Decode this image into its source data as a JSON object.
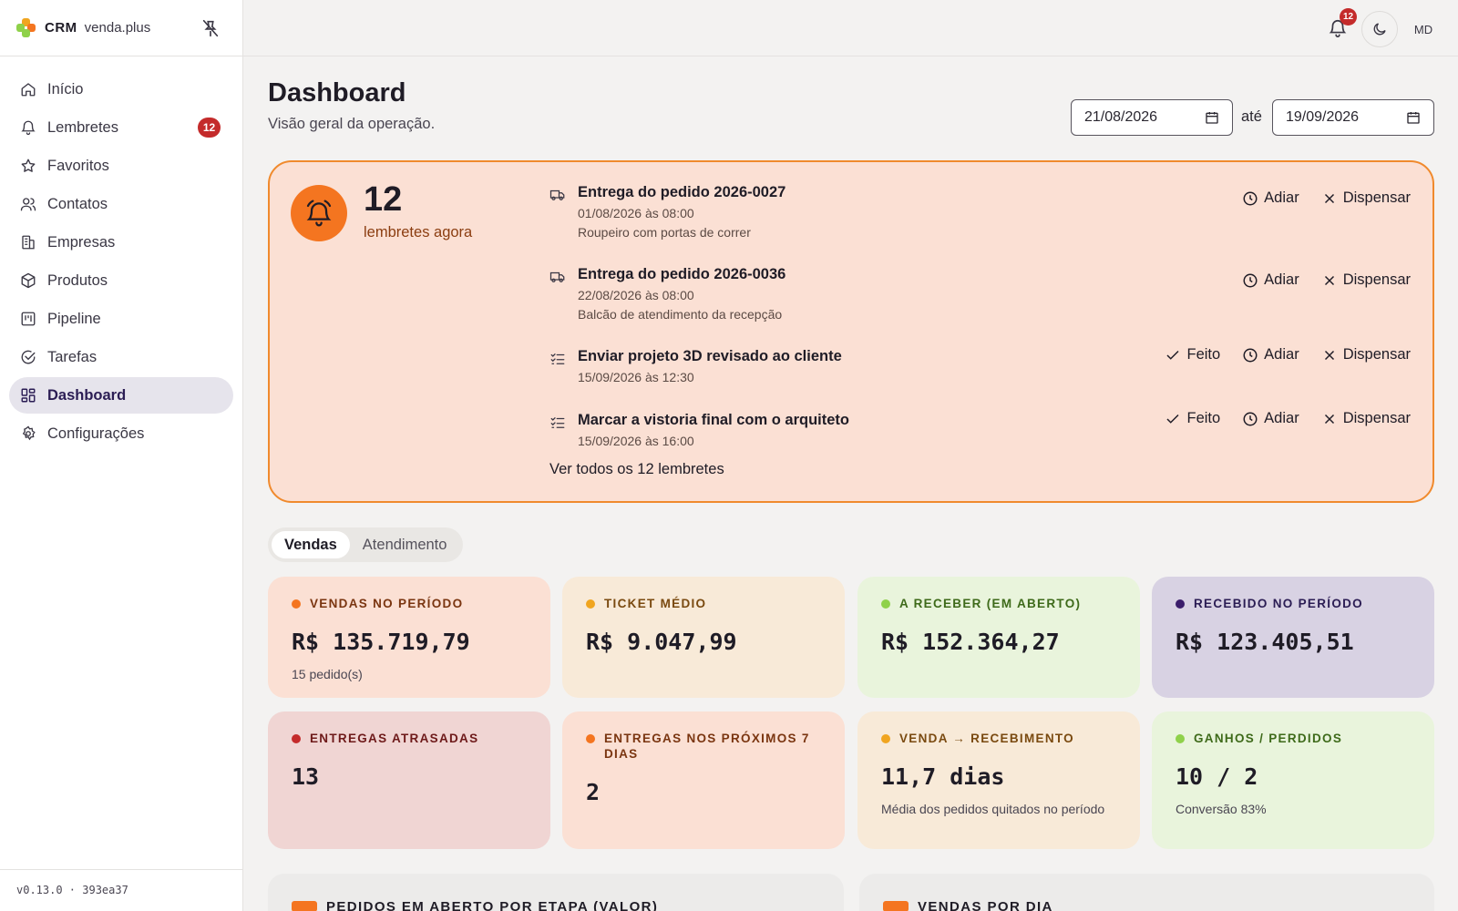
{
  "app": {
    "brand": "CRM",
    "brand_sub": "venda.plus",
    "version": "v0.13.0 · 393ea37"
  },
  "colors": {
    "accent": "#f47520",
    "badge": "#c42b2b",
    "active_nav": "#e6e4ec"
  },
  "sidebar": {
    "items": [
      {
        "label": "Início",
        "icon": "home-icon"
      },
      {
        "label": "Lembretes",
        "icon": "bell-icon",
        "badge": "12"
      },
      {
        "label": "Favoritos",
        "icon": "star-icon"
      },
      {
        "label": "Contatos",
        "icon": "users-icon"
      },
      {
        "label": "Empresas",
        "icon": "building-icon"
      },
      {
        "label": "Produtos",
        "icon": "package-icon"
      },
      {
        "label": "Pipeline",
        "icon": "kanban-icon"
      },
      {
        "label": "Tarefas",
        "icon": "check-circle-icon"
      },
      {
        "label": "Dashboard",
        "icon": "dashboard-icon",
        "active": true
      },
      {
        "label": "Configurações",
        "icon": "gear-icon"
      }
    ]
  },
  "topbar": {
    "notification_count": "12",
    "avatar_initials": "MD"
  },
  "header": {
    "title": "Dashboard",
    "subtitle": "Visão geral da operação.",
    "date_from": "21/08/2026",
    "date_separator": "até",
    "date_to": "19/09/2026"
  },
  "reminders": {
    "count": "12",
    "count_label": "lembretes agora",
    "items": [
      {
        "icon": "truck-icon",
        "title": "Entrega do pedido 2026-0027",
        "when": "01/08/2026 às 08:00",
        "description": "Roupeiro com portas de correr",
        "actions": [
          "Adiar",
          "Dispensar"
        ]
      },
      {
        "icon": "truck-icon",
        "title": "Entrega do pedido 2026-0036",
        "when": "22/08/2026 às 08:00",
        "description": "Balcão de atendimento da recepção",
        "actions": [
          "Adiar",
          "Dispensar"
        ]
      },
      {
        "icon": "task-list-icon",
        "title": "Enviar projeto 3D revisado ao cliente",
        "when": "15/09/2026 às 12:30",
        "description": "",
        "actions": [
          "Feito",
          "Adiar",
          "Dispensar"
        ]
      },
      {
        "icon": "task-list-icon",
        "title": "Marcar a vistoria final com o arquiteto",
        "when": "15/09/2026 às 16:00",
        "description": "",
        "actions": [
          "Feito",
          "Adiar",
          "Dispensar"
        ]
      }
    ],
    "view_all": "Ver todos os 12 lembretes"
  },
  "tabs": [
    {
      "label": "Vendas",
      "active": true
    },
    {
      "label": "Atendimento",
      "active": false
    }
  ],
  "kpis": [
    {
      "label": "Vendas no período",
      "value": "R$ 135.719,79",
      "sub": "15 pedido(s)",
      "bg": "#fbe0d4",
      "dot": "#f47520",
      "label_color": "#7a3510"
    },
    {
      "label": "Ticket médio",
      "value": "R$ 9.047,99",
      "sub": "",
      "bg": "#f8ead8",
      "dot": "#f0a520",
      "label_color": "#7a4a10"
    },
    {
      "label": "A receber (em aberto)",
      "value": "R$ 152.364,27",
      "sub": "",
      "bg": "#e9f4dc",
      "dot": "#8fd14a",
      "label_color": "#3e6a1a"
    },
    {
      "label": "Recebido no período",
      "value": "R$ 123.405,51",
      "sub": "",
      "bg": "#d8d2e3",
      "dot": "#3b1d6b",
      "label_color": "#2b1d54"
    },
    {
      "label": "Entregas atrasadas",
      "value": "13",
      "sub": "",
      "bg": "#f0d5d3",
      "dot": "#c42b2b",
      "label_color": "#6e1a1a"
    },
    {
      "label": "Entregas nos próximos 7 dias",
      "value": "2",
      "sub": "",
      "bg": "#fbe0d4",
      "dot": "#f47520",
      "label_color": "#7a3510"
    },
    {
      "label": "Venda → recebimento",
      "value": "11,7 dias",
      "sub": "Média dos pedidos quitados no período",
      "bg": "#f8ead8",
      "dot": "#f0a520",
      "label_color": "#7a4a10"
    },
    {
      "label": "Ganhos / perdidos",
      "value": "10 / 2",
      "sub": "Conversão 83%",
      "bg": "#e9f4dc",
      "dot": "#8fd14a",
      "label_color": "#3e6a1a"
    }
  ],
  "sections": [
    {
      "title": "PEDIDOS EM ABERTO POR ETAPA (VALOR)"
    },
    {
      "title": "VENDAS POR DIA"
    }
  ]
}
